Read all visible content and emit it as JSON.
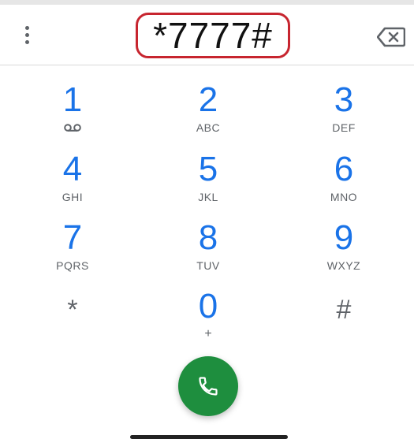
{
  "dialer": {
    "entered_number": "*7777#",
    "keys": [
      {
        "digit": "1",
        "letters": ""
      },
      {
        "digit": "2",
        "letters": "ABC"
      },
      {
        "digit": "3",
        "letters": "DEF"
      },
      {
        "digit": "4",
        "letters": "GHI"
      },
      {
        "digit": "5",
        "letters": "JKL"
      },
      {
        "digit": "6",
        "letters": "MNO"
      },
      {
        "digit": "7",
        "letters": "PQRS"
      },
      {
        "digit": "8",
        "letters": "TUV"
      },
      {
        "digit": "9",
        "letters": "WXYZ"
      },
      {
        "symbol": "*"
      },
      {
        "digit": "0",
        "letters": "+"
      },
      {
        "symbol": "#"
      }
    ],
    "icons": {
      "menu": "more-vert-icon",
      "backspace": "backspace-icon",
      "voicemail": "voicemail-icon",
      "call": "phone-icon"
    },
    "colors": {
      "digit": "#1a73e8",
      "call_button": "#1e8e3e",
      "highlight_border": "#c7252f"
    }
  }
}
